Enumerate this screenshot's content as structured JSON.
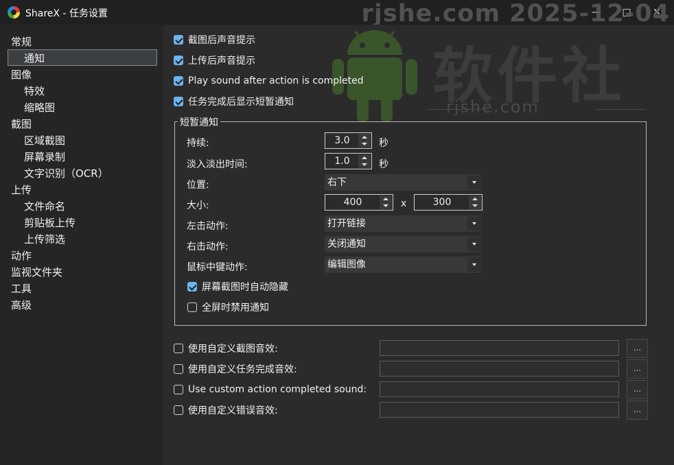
{
  "window": {
    "title": "ShareX - 任务设置"
  },
  "watermark": {
    "url_date": "rjshe.com 2025-12-04",
    "brand": "软件社",
    "domain": "rjshe.com"
  },
  "sidebar": {
    "items": [
      {
        "label": "常规"
      },
      {
        "label": "通知",
        "selected": true
      },
      {
        "label": "图像"
      },
      {
        "label": "特效"
      },
      {
        "label": "缩略图"
      },
      {
        "label": "截图"
      },
      {
        "label": "区域截图"
      },
      {
        "label": "屏幕录制"
      },
      {
        "label": "文字识别（OCR）"
      },
      {
        "label": "上传"
      },
      {
        "label": "文件命名"
      },
      {
        "label": "剪贴板上传"
      },
      {
        "label": "上传筛选"
      },
      {
        "label": "动作"
      },
      {
        "label": "监视文件夹"
      },
      {
        "label": "工具"
      },
      {
        "label": "高级"
      }
    ]
  },
  "notifications": {
    "top_checks": [
      {
        "label": "截图后声音提示",
        "checked": true
      },
      {
        "label": "上传后声音提示",
        "checked": true
      },
      {
        "label": "Play sound after action is completed",
        "checked": true
      },
      {
        "label": "任务完成后显示短暂通知",
        "checked": true
      }
    ],
    "toast": {
      "group_title": "短暂通知",
      "duration_label": "持续:",
      "duration_value": "3.0",
      "duration_unit": "秒",
      "fade_label": "淡入淡出时间:",
      "fade_value": "1.0",
      "fade_unit": "秒",
      "position_label": "位置:",
      "position_value": "右下",
      "size_label": "大小:",
      "width_value": "400",
      "size_x": "x",
      "height_value": "300",
      "left_click_label": "左击动作:",
      "left_click_value": "打开链接",
      "right_click_label": "右击动作:",
      "right_click_value": "关闭通知",
      "middle_click_label": "鼠标中键动作:",
      "middle_click_value": "编辑图像",
      "auto_hide_label": "屏幕截图时自动隐藏",
      "auto_hide_checked": true,
      "fullscreen_label": "全屏时禁用通知",
      "fullscreen_checked": false
    },
    "custom_sounds": [
      {
        "label": "使用自定义截图音效:",
        "checked": false,
        "path": "",
        "browse": "..."
      },
      {
        "label": "使用自定义任务完成音效:",
        "checked": false,
        "path": "",
        "browse": "..."
      },
      {
        "label": "Use custom action completed sound:",
        "checked": false,
        "path": "",
        "browse": "..."
      },
      {
        "label": "使用自定义错误音效:",
        "checked": false,
        "path": "",
        "browse": "..."
      }
    ]
  }
}
